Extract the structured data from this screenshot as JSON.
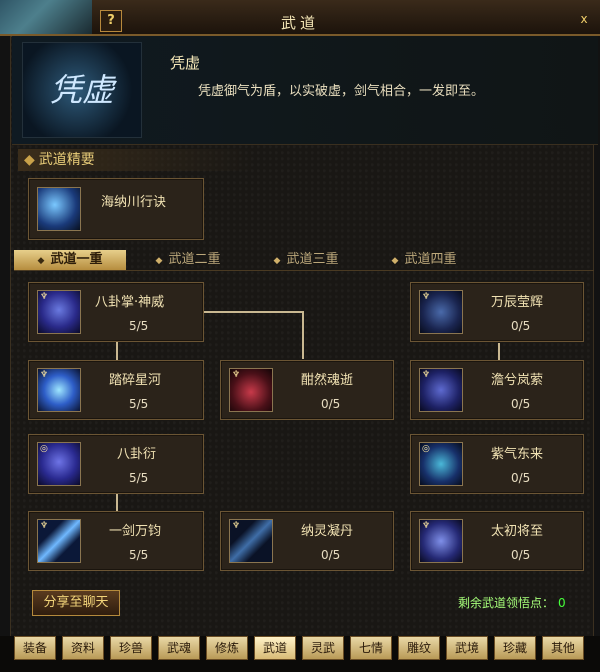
{
  "window": {
    "title": "武道",
    "help": "?",
    "close": "x"
  },
  "header": {
    "emblem": "凭虚",
    "skill_name": "凭虚",
    "description": "凭虚御气为盾，以实破虚，剑气相合，一发即至。"
  },
  "essentials": {
    "section_title": "武道精要",
    "item": {
      "name": "海纳川行诀"
    }
  },
  "tabs": [
    {
      "label": "武道一重",
      "active": true
    },
    {
      "label": "武道二重",
      "active": false
    },
    {
      "label": "武道三重",
      "active": false
    },
    {
      "label": "武道四重",
      "active": false
    }
  ],
  "skills": {
    "left": [
      {
        "name": "八卦掌·神威",
        "level": "5/5"
      },
      {
        "name": "踏碎星河",
        "level": "5/5"
      },
      {
        "name": "八卦衍",
        "level": "5/5"
      },
      {
        "name": "一剑万钧",
        "level": "5/5"
      }
    ],
    "middle": [
      {
        "name": "酣然魂逝",
        "level": "0/5"
      },
      {
        "name": "纳灵凝丹",
        "level": "0/5"
      }
    ],
    "right": [
      {
        "name": "万辰莹辉",
        "level": "0/5"
      },
      {
        "name": "澹兮岚萦",
        "level": "0/5"
      },
      {
        "name": "紫气东来",
        "level": "0/5"
      },
      {
        "name": "太初将至",
        "level": "0/5"
      }
    ]
  },
  "footer": {
    "share_label": "分享至聊天",
    "points_label": "剩余武道领悟点：",
    "points_value": "0"
  },
  "bottom_tabs": [
    "装备",
    "资料",
    "珍兽",
    "武魂",
    "修炼",
    "武道",
    "灵武",
    "七情",
    "雕纹",
    "武境",
    "珍藏",
    "其他"
  ],
  "colors": {
    "gold": "#e9cd79",
    "points_green": "#45ff3a"
  }
}
